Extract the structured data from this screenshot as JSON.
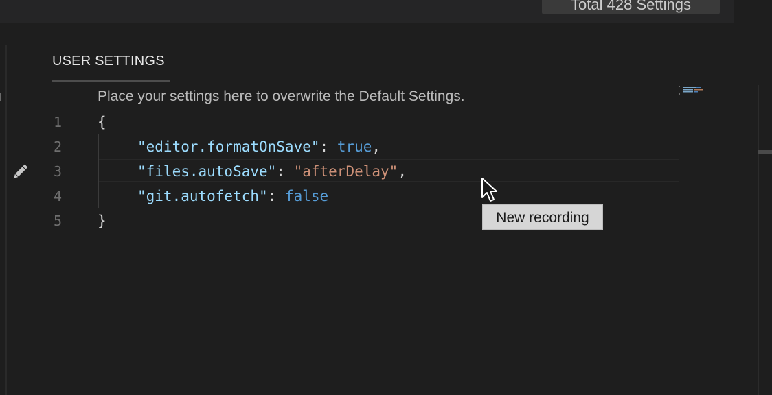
{
  "header": {
    "settings_count": "Total 428 Settings"
  },
  "section": {
    "title": "USER SETTINGS",
    "hint": "Place your settings here to overwrite the Default Settings."
  },
  "editor": {
    "line_numbers": [
      "1",
      "2",
      "3",
      "4",
      "5"
    ],
    "open_brace": "{",
    "close_brace": "}",
    "settings": [
      {
        "key": "\"editor.formatOnSave\"",
        "sep": ": ",
        "value": "true",
        "trail": ","
      },
      {
        "key": "\"files.autoSave\"",
        "sep": ": ",
        "value": "\"afterDelay\"",
        "trail": ","
      },
      {
        "key": "\"git.autofetch\"",
        "sep": ": ",
        "value": "false",
        "trail": ""
      }
    ],
    "current_line": 3
  },
  "icons": {
    "edit": "pencil-icon",
    "pointer": "mouse-cursor-icon"
  },
  "tooltip": {
    "text": "New recording"
  },
  "colors": {
    "background": "#1e1e1e",
    "key": "#9cdcfe",
    "string": "#ce9178",
    "boolean": "#569cd6"
  }
}
